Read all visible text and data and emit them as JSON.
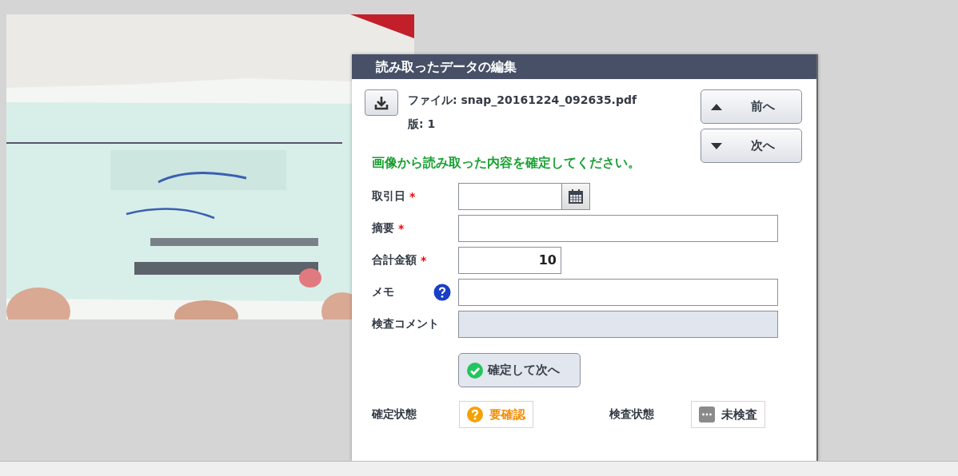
{
  "dialog": {
    "title": "読み取ったデータの編集",
    "file": "ファイル: snap_20161224_092635.pdf",
    "version": "版: 1",
    "nav": [
      {
        "label": "前へ",
        "kind": "up"
      },
      {
        "label": "次へ",
        "kind": "down"
      }
    ],
    "message": "画像から読み取った内容を確定してください。",
    "required_mark": "*",
    "fields": [
      {
        "label": "取引日",
        "required": true,
        "kind": "date"
      },
      {
        "label": "摘要",
        "required": true,
        "kind": "text"
      },
      {
        "label": "合計金額",
        "required": true,
        "kind": "amount",
        "value": "10"
      },
      {
        "label": "メモ",
        "required": false,
        "kind": "help"
      },
      {
        "label": "検査コメント",
        "required": false,
        "kind": "disabled"
      }
    ],
    "confirm_button": "確定して次へ",
    "statuses": [
      {
        "label": "確定状態",
        "value": "要確認",
        "kind": "warning"
      },
      {
        "label": "検査状態",
        "value": "未検査",
        "kind": "pending"
      }
    ]
  }
}
